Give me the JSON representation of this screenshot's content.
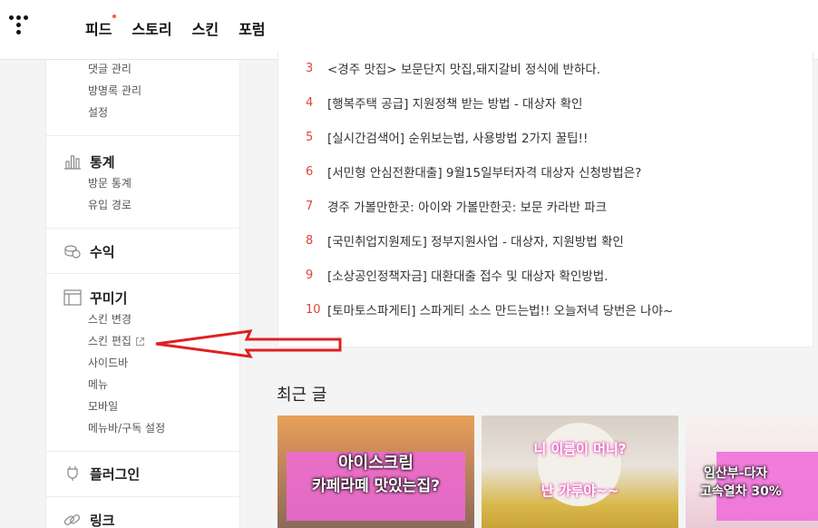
{
  "topnav": {
    "items": [
      {
        "label": "피드",
        "has_dot": true
      },
      {
        "label": "스토리",
        "has_dot": false
      },
      {
        "label": "스킨",
        "has_dot": false
      },
      {
        "label": "포럼",
        "has_dot": false
      }
    ]
  },
  "sidebar": {
    "top_links": [
      "댓글 관리",
      "방명록 관리",
      "설정"
    ],
    "stats": {
      "title": "통계",
      "icon": "bar-chart-icon",
      "links": [
        "방문 통계",
        "유입 경로"
      ]
    },
    "revenue": {
      "title": "수익",
      "icon": "coins-icon"
    },
    "decorate": {
      "title": "꾸미기",
      "icon": "layout-icon",
      "links": [
        "스킨 변경",
        "스킨 편집",
        "사이드바",
        "메뉴",
        "모바일",
        "메뉴바/구독 설정"
      ]
    },
    "plugin": {
      "title": "플러그인",
      "icon": "plug-icon"
    },
    "link": {
      "title": "링크",
      "icon": "link-icon"
    }
  },
  "popular": {
    "items": [
      {
        "num": "3",
        "text": "<경주 맛집> 보문단지 맛집,돼지갈비 정식에 반하다."
      },
      {
        "num": "4",
        "text": "[행복주택 공급] 지원정책 받는 방법 - 대상자 확인"
      },
      {
        "num": "5",
        "text": "[실시간검색어] 순위보는법, 사용방법 2가지 꿀팁!!"
      },
      {
        "num": "6",
        "text": "[서민형 안심전환대출] 9월15일부터자격 대상자 신청방법은?"
      },
      {
        "num": "7",
        "text": "경주 가볼만한곳: 아이와 가볼만한곳: 보문 카라반 파크"
      },
      {
        "num": "8",
        "text": "[국민취업지원제도] 정부지원사업 - 대상자, 지원방법 확인"
      },
      {
        "num": "9",
        "text": "[소상공인정책자금] 대환대출 접수 및 대상자 확인방법."
      },
      {
        "num": "10",
        "text": "[토마토스파게티] 스파게티 소스 만드는법!! 오늘저녁 당번은 나야~"
      }
    ]
  },
  "recent": {
    "title": "최근 글",
    "thumbs": [
      {
        "line1": "아이스크림",
        "line2": "카페라떼 맛있는집?"
      },
      {
        "line1": "니 이름이 머니?",
        "line2": "난 가루야~~"
      },
      {
        "line1": "임산부-다자",
        "line2": "고속열차 30%"
      }
    ]
  },
  "colors": {
    "accent_red": "#e0443a",
    "arrow_red": "#e02020"
  }
}
